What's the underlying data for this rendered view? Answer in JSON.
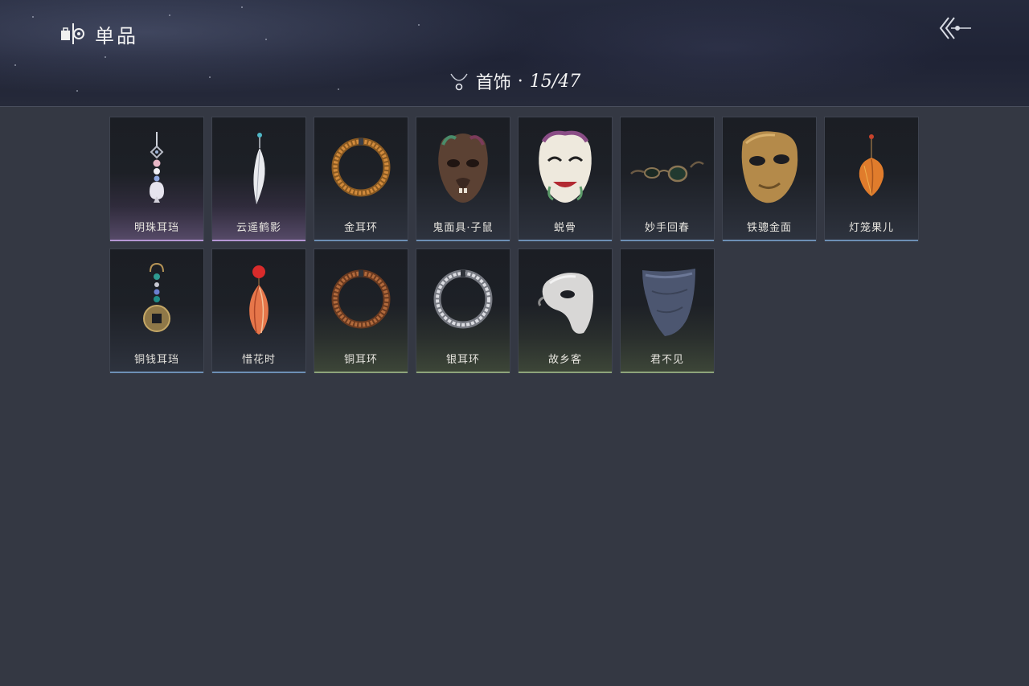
{
  "header": {
    "title": "单品",
    "brand_icon": "tag-icon",
    "back_icon": "double-chevron-left-icon"
  },
  "category": {
    "icon": "necklace-icon",
    "name": "首饰",
    "separator": "·",
    "count": "15/47"
  },
  "items": [
    {
      "name": "明珠耳珰",
      "rarity": "purple",
      "icon": "pearl-earring-icon"
    },
    {
      "name": "云遥鹤影",
      "rarity": "purple",
      "icon": "feather-earring-icon"
    },
    {
      "name": "金耳环",
      "rarity": "blue",
      "icon": "gold-hoop-earring-icon"
    },
    {
      "name": "鬼面具·子鼠",
      "rarity": "blue",
      "icon": "rat-mask-icon"
    },
    {
      "name": "蜕骨",
      "rarity": "blue",
      "icon": "opera-mask-icon"
    },
    {
      "name": "妙手回春",
      "rarity": "blue",
      "icon": "spectacles-icon"
    },
    {
      "name": "铁骢金面",
      "rarity": "blue",
      "icon": "gold-mask-icon"
    },
    {
      "name": "灯笼果儿",
      "rarity": "blue",
      "icon": "lantern-fruit-earring-icon"
    },
    {
      "name": "铜钱耳珰",
      "rarity": "blue",
      "icon": "coin-earring-icon"
    },
    {
      "name": "惜花时",
      "rarity": "blue",
      "icon": "petal-earring-icon"
    },
    {
      "name": "铜耳环",
      "rarity": "green",
      "icon": "copper-hoop-earring-icon"
    },
    {
      "name": "银耳环",
      "rarity": "green",
      "icon": "silver-hoop-earring-icon"
    },
    {
      "name": "故乡客",
      "rarity": "green",
      "icon": "half-mask-icon"
    },
    {
      "name": "君不见",
      "rarity": "green",
      "icon": "face-veil-icon"
    }
  ],
  "colors": {
    "background": "#343843",
    "rarity_purple": "#b496d4",
    "rarity_blue": "#6d8fb5",
    "rarity_green": "#8ea47b"
  }
}
